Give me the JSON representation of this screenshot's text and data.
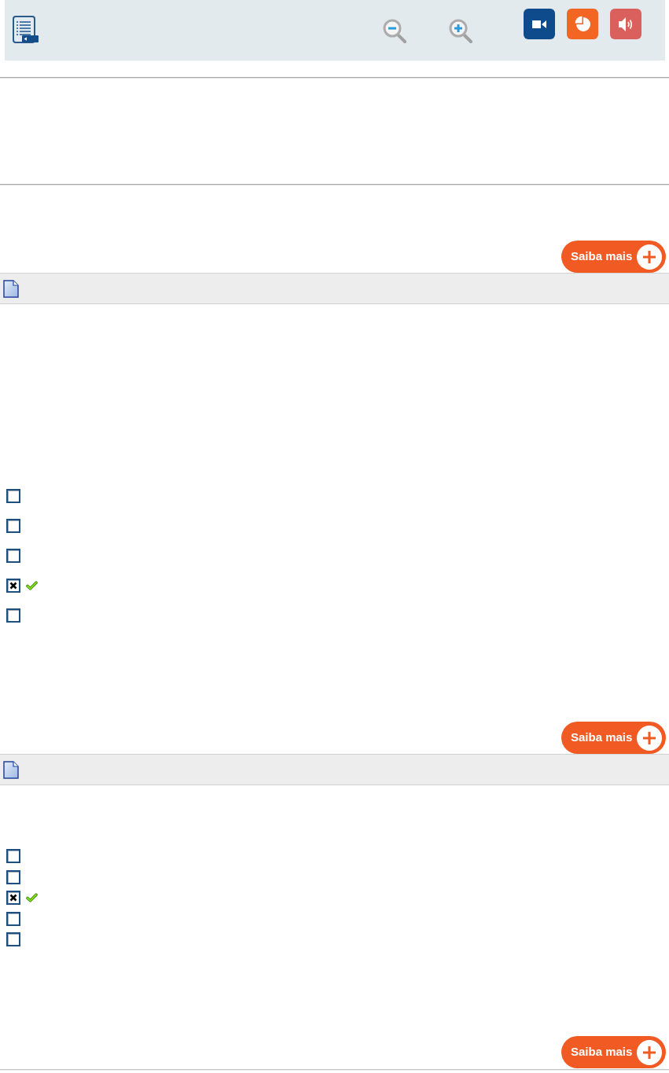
{
  "intro": {
    "more_button": "Saiba mais"
  },
  "questions": [
    {
      "options": [
        {
          "checked": false,
          "correct": false
        },
        {
          "checked": false,
          "correct": false
        },
        {
          "checked": false,
          "correct": false
        },
        {
          "checked": true,
          "correct": true
        },
        {
          "checked": false,
          "correct": false
        }
      ],
      "more_button": "Saiba mais"
    },
    {
      "options": [
        {
          "checked": false,
          "correct": false
        },
        {
          "checked": false,
          "correct": false
        },
        {
          "checked": true,
          "correct": true
        },
        {
          "checked": false,
          "correct": false
        },
        {
          "checked": false,
          "correct": false
        }
      ],
      "more_button": "Saiba mais"
    }
  ]
}
